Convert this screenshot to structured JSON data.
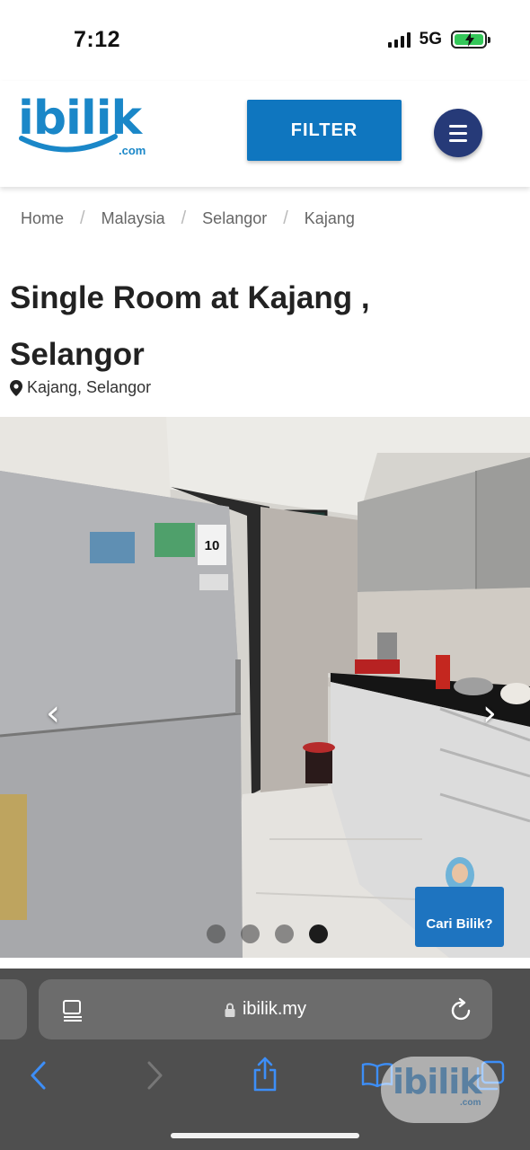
{
  "status_bar": {
    "time": "7:12",
    "network": "5G",
    "battery_level": 1.0,
    "battery_color": "#34c759"
  },
  "header": {
    "logo_text": "ibilik",
    "logo_suffix": ".com",
    "filter_label": "FILTER",
    "menu_icon": "hamburger-icon",
    "brand_color": "#0f76bf",
    "menu_color": "#263a78"
  },
  "breadcrumb": {
    "items": [
      "Home",
      "Malaysia",
      "Selangor",
      "Kajang"
    ],
    "separator": "/"
  },
  "listing": {
    "title": "Single Room at Kajang , Selangor",
    "location": "Kajang, Selangor",
    "location_icon": "map-pin-icon"
  },
  "gallery": {
    "prev_icon": "chevron-left-icon",
    "next_icon": "chevron-right-icon",
    "slide_count": 4,
    "active_slide": 4,
    "fridge_badge": "10",
    "cta_label": "Cari Bilik?"
  },
  "browser": {
    "url": "ibilik.my",
    "lock_icon": "lock-icon",
    "reader_icon": "reader-icon",
    "reload_icon": "reload-icon",
    "toolbar": [
      "back-icon",
      "forward-icon",
      "share-icon",
      "bookmarks-icon",
      "tabs-icon"
    ]
  },
  "watermark": {
    "text": "ibilik",
    "suffix": ".com"
  }
}
